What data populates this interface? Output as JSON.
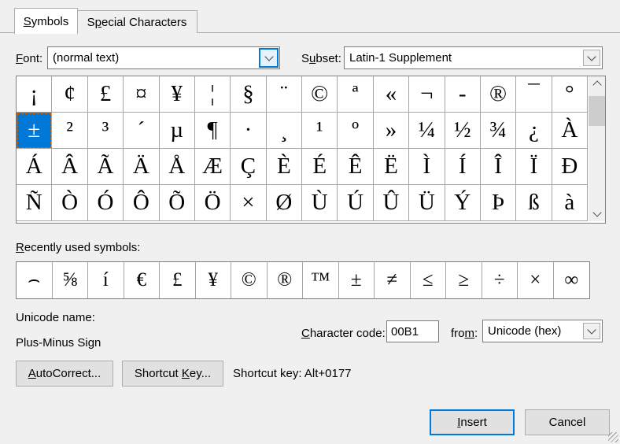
{
  "tabs": [
    {
      "pre": "",
      "key": "S",
      "post": "ymbols"
    },
    {
      "pre": "S",
      "key": "p",
      "post": "ecial Characters"
    }
  ],
  "font": {
    "label_pre": "",
    "label_key": "F",
    "label_post": "ont:",
    "value": "(normal text)"
  },
  "subset": {
    "label_pre": "S",
    "label_key": "u",
    "label_post": "bset:",
    "value": "Latin-1 Supplement"
  },
  "symbols_grid": {
    "rows": [
      [
        "¡",
        "¢",
        "£",
        "¤",
        "¥",
        "¦",
        "§",
        "¨",
        "©",
        "ª",
        "«",
        "¬",
        "-",
        "®",
        "¯",
        "°"
      ],
      [
        "±",
        "²",
        "³",
        "´",
        "µ",
        "¶",
        "·",
        "¸",
        "¹",
        "º",
        "»",
        "¼",
        "½",
        "¾",
        "¿",
        "À"
      ],
      [
        "Á",
        "Â",
        "Ã",
        "Ä",
        "Å",
        "Æ",
        "Ç",
        "È",
        "É",
        "Ê",
        "Ë",
        "Ì",
        "Í",
        "Î",
        "Ï",
        "Ð"
      ],
      [
        "Ñ",
        "Ò",
        "Ó",
        "Ô",
        "Õ",
        "Ö",
        "×",
        "Ø",
        "Ù",
        "Ú",
        "Û",
        "Ü",
        "Ý",
        "Þ",
        "ß",
        "à"
      ]
    ],
    "selected": {
      "row": 1,
      "col": 0
    }
  },
  "recent": {
    "label_pre": "",
    "label_key": "R",
    "label_post": "ecently used symbols:",
    "symbols": [
      "⌢",
      "⅝",
      "í",
      "€",
      "£",
      "¥",
      "©",
      "®",
      "™",
      "±",
      "≠",
      "≤",
      "≥",
      "÷",
      "×",
      "∞"
    ]
  },
  "unicode_name": {
    "label": "Unicode name:",
    "value": "Plus-Minus Sign"
  },
  "char_code": {
    "label_pre": "",
    "label_key": "C",
    "label_post": "haracter code:",
    "value": "00B1"
  },
  "from": {
    "label_pre": "fro",
    "label_key": "m",
    "label_post": ":",
    "value": "Unicode (hex)"
  },
  "buttons": {
    "autocorrect": {
      "pre": "",
      "key": "A",
      "post": "utoCorrect..."
    },
    "shortcut_key": {
      "pre": "Shortcut ",
      "key": "K",
      "post": "ey..."
    },
    "insert": {
      "pre": "",
      "key": "I",
      "post": "nsert"
    },
    "cancel": {
      "label": "Cancel"
    }
  },
  "shortcut_text": "Shortcut key: Alt+0177",
  "colors": {
    "selection": "#0078d7",
    "accent": "#0078d7",
    "dialog_bg": "#f0f0f0",
    "marquee": "#c46210"
  }
}
